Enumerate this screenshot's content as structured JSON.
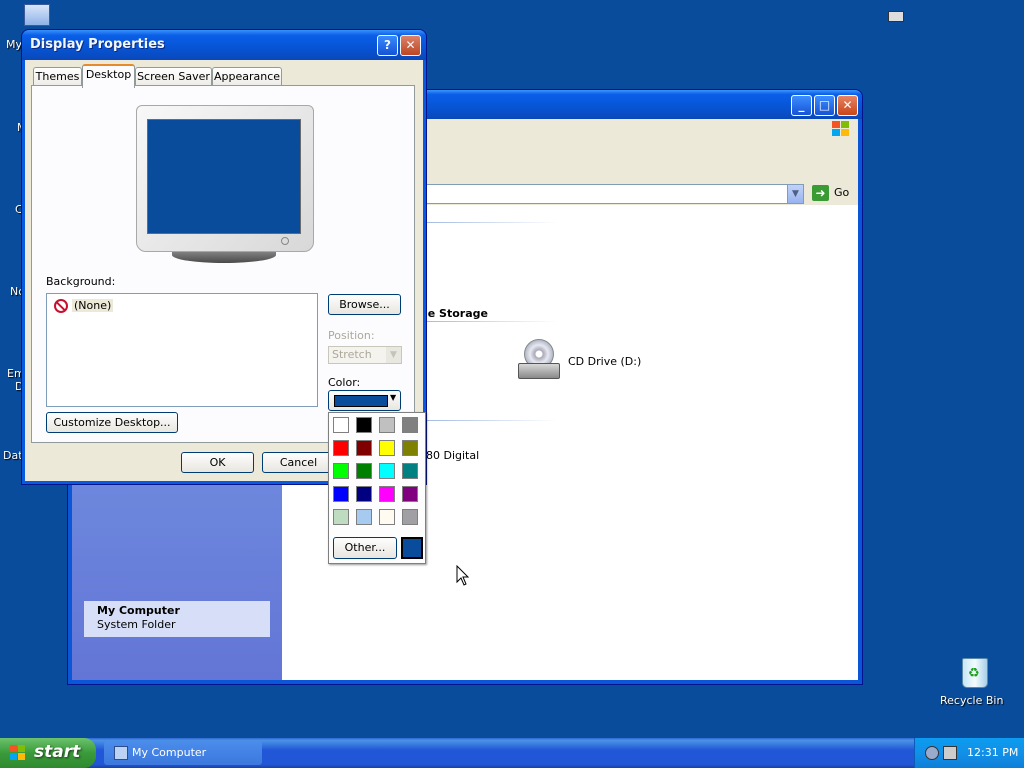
{
  "desktop": {
    "left_icon_labels": [
      "My",
      "M",
      "C",
      "Nc",
      "Em",
      "D",
      "Dat"
    ],
    "recycle_bin_label": "Recycle Bin"
  },
  "my_computer_window": {
    "address_go_label": "Go",
    "content": {
      "section_removable": "le Storage",
      "cd_drive_label": "CD Drive (D:)",
      "other_item_label": "80 Digital"
    },
    "details": {
      "title": "My Computer",
      "subtitle": "System Folder"
    }
  },
  "display_properties": {
    "title": "Display Properties",
    "tabs": [
      {
        "label": "Themes",
        "active": false
      },
      {
        "label": "Desktop",
        "active": true
      },
      {
        "label": "Screen Saver",
        "active": false
      },
      {
        "label": "Appearance",
        "active": false
      }
    ],
    "background_label": "Background:",
    "background_items": [
      "(None)"
    ],
    "browse_label": "Browse...",
    "position_label": "Position:",
    "position_value": "Stretch",
    "color_label": "Color:",
    "current_color": "#0a4c9c",
    "customize_label": "Customize Desktop...",
    "ok_label": "OK",
    "cancel_label": "Cancel"
  },
  "color_picker": {
    "swatches": [
      "#ffffff",
      "#000000",
      "#c0c0c0",
      "#808080",
      "#ff0000",
      "#800000",
      "#ffff00",
      "#808000",
      "#00ff00",
      "#008000",
      "#00ffff",
      "#008080",
      "#0000ff",
      "#000080",
      "#ff00ff",
      "#800080",
      "#c0dcc0",
      "#a6caf0",
      "#fffbf0",
      "#a0a0a4"
    ],
    "other_label": "Other..."
  },
  "taskbar": {
    "start_label": "start",
    "task_label": "My Computer",
    "clock": "12:31 PM"
  }
}
